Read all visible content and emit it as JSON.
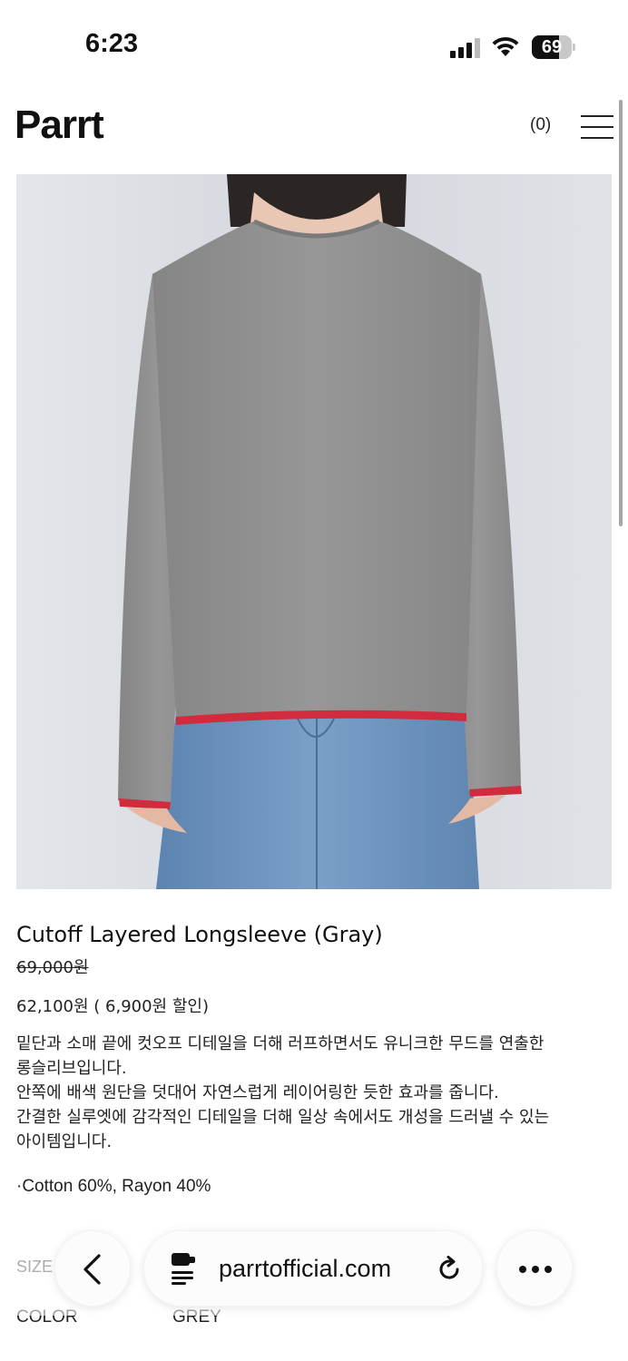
{
  "status_bar": {
    "time": "6:23",
    "battery": 69
  },
  "header": {
    "logo": "Parrt",
    "cart_count": "(0)"
  },
  "product": {
    "title": "Cutoff Layered Longsleeve (Gray)",
    "original_price": "69,000원",
    "sale_price": "62,100원",
    "discount": "( 6,900원 할인)",
    "description": [
      "밑단과 소매 끝에 컷오프 디테일을 더해 러프하면서도 유니크한 무드를 연출한",
      "롱슬리브입니다.",
      "안쪽에 배색 원단을 덧대어 자연스럽게 레이어링한 듯한 효과를 줍니다.",
      "간결한 실루엣에 감각적인 디테일을 더해 일상 속에서도 개성을 드러낼 수 있는",
      "아이템입니다."
    ],
    "material": "·Cotton 60%, Rayon 40%"
  },
  "options": {
    "size_label": "SIZE",
    "color_label": "COLOR",
    "color_value": "GREY"
  },
  "browser": {
    "url": "parrtofficial.com"
  },
  "colors": {
    "sweater": "#8f8f8f",
    "trim": "#d12b3e",
    "denim": "#6f94bd",
    "backdrop": "#d9dde2"
  }
}
